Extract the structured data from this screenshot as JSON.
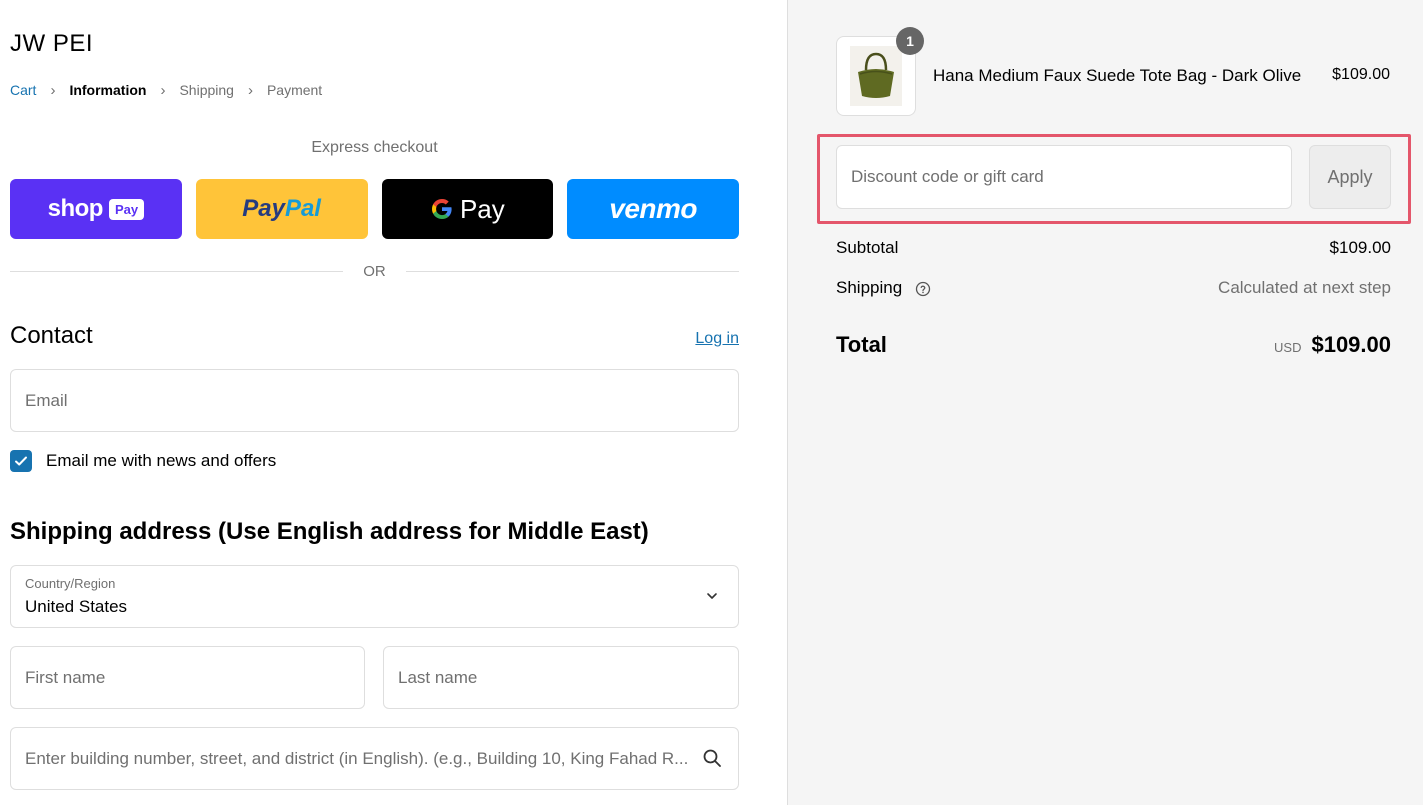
{
  "brand": "JW PEI",
  "breadcrumb": {
    "cart": "Cart",
    "information": "Information",
    "shipping": "Shipping",
    "payment": "Payment"
  },
  "express": {
    "label": "Express checkout",
    "shop_pay": {
      "word": "shop",
      "tag": "Pay"
    },
    "paypal": {
      "part1": "Pay",
      "part2": "Pal"
    },
    "gpay": {
      "word": "Pay"
    },
    "venmo": {
      "word": "venmo"
    },
    "or": "OR"
  },
  "contact": {
    "title": "Contact",
    "login": "Log in",
    "email_placeholder": "Email",
    "newsletter_label": "Email me with news and offers",
    "newsletter_checked": true
  },
  "shipping_address": {
    "title": "Shipping address (Use English address for Middle East)",
    "country_label": "Country/Region",
    "country_value": "United States",
    "first_name_placeholder": "First name",
    "last_name_placeholder": "Last name",
    "address_placeholder": "Enter building number, street, and district (in English). (e.g., Building 10, King Fahad R..."
  },
  "order": {
    "item": {
      "quantity": "1",
      "name": "Hana Medium Faux Suede Tote Bag - Dark Olive",
      "price": "$109.00"
    },
    "discount_placeholder": "Discount code or gift card",
    "apply_label": "Apply",
    "subtotal_label": "Subtotal",
    "subtotal_value": "$109.00",
    "shipping_label": "Shipping",
    "shipping_value": "Calculated at next step",
    "total_label": "Total",
    "currency": "USD",
    "total_value": "$109.00"
  },
  "colors": {
    "accent": "#1773b0",
    "shop_pay": "#5a31f4",
    "paypal": "#ffc439",
    "gpay": "#000000",
    "venmo": "#008cff",
    "highlight": "#e4566b"
  }
}
